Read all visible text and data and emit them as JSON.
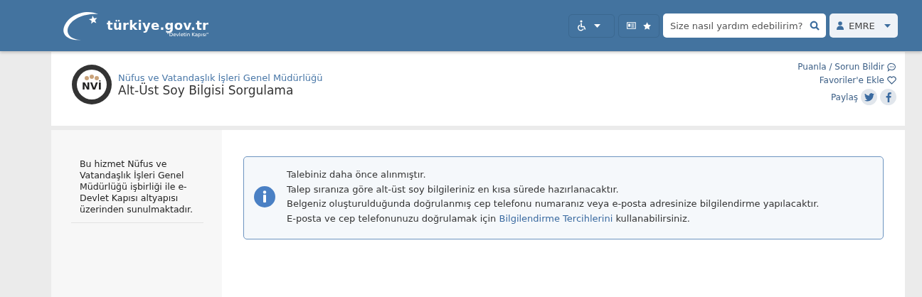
{
  "header": {
    "logo_text": "türkiye.gov.tr",
    "logo_slogan": "\"Devletin Kapısı\"",
    "search": {
      "placeholder": "Size nasıl yardım edebilirim?"
    },
    "user": {
      "name": "EMRE"
    }
  },
  "service": {
    "agency": "Nüfus ve Vatandaşlık İşleri Genel Müdürlüğü",
    "title": "Alt-Üst Soy Bilgisi Sorgulama",
    "emblem_text": "NVİ",
    "links": [
      {
        "kind": "rate",
        "label": "Puanla / Sorun Bildir"
      },
      {
        "kind": "favorite",
        "label": "Favoriler'e Ekle"
      },
      {
        "kind": "share",
        "label": "Paylaş"
      }
    ]
  },
  "sidebar": {
    "text": "Bu hizmet Nüfus ve Vatandaşlık İşleri Genel Müdürlüğü işbirliği ile e-Devlet Kapısı altyapısı üzerinden sunulmaktadır."
  },
  "notice": {
    "lines": [
      "Talebiniz daha önce alınmıştır.",
      "Talep sıranıza göre alt-üst soy bilgileriniz en kısa sürede hazırlanacaktır.",
      "Belgeniz oluşturulduğunda doğrulanmış cep telefonu numaranız veya e-posta adresinize bilgilendirme yapılacaktır."
    ],
    "last_line": {
      "before": "E-posta ve cep telefonunuzu doğrulamak için",
      "link": "Bilgilendirme Tercihlerini",
      "after": "kullanabilirsiniz."
    }
  }
}
